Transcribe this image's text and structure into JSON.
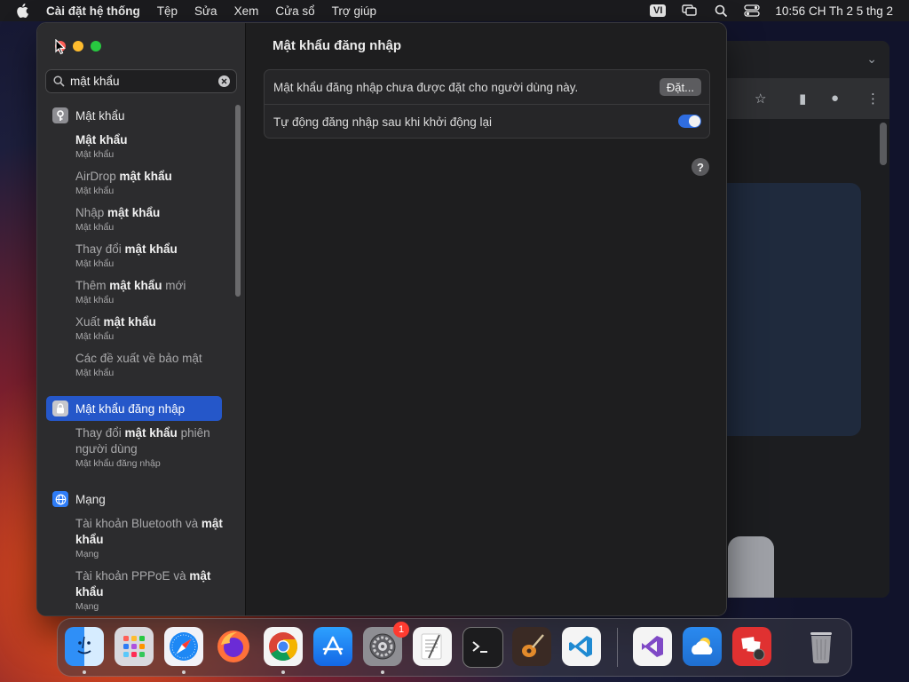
{
  "menubar": {
    "app": "Cài đặt hệ thống",
    "items": [
      "Tệp",
      "Sửa",
      "Xem",
      "Cửa sổ",
      "Trợ giúp"
    ],
    "input_method": "VI",
    "clock": "10:56 CH Th 2 5 thg 2"
  },
  "search": {
    "value": "mật khẩu"
  },
  "sidebar": {
    "sec1": {
      "label": "Mật khẩu"
    },
    "sec1_results": [
      {
        "before": "",
        "bold": "Mật khẩu",
        "after": "",
        "sub": "Mật khẩu"
      },
      {
        "before": "AirDrop ",
        "bold": "mật khẩu",
        "after": "",
        "sub": "Mật khẩu"
      },
      {
        "before": "Nhập ",
        "bold": "mật khẩu",
        "after": "",
        "sub": "Mật khẩu"
      },
      {
        "before": "Thay đổi ",
        "bold": "mật khẩu",
        "after": "",
        "sub": "Mật khẩu"
      },
      {
        "before": "Thêm ",
        "bold": "mật khẩu",
        "after": " mới",
        "sub": "Mật khẩu"
      },
      {
        "before": "Xuất ",
        "bold": "mật khẩu",
        "after": "",
        "sub": "Mật khẩu"
      },
      {
        "before": "Các đề xuất về bảo mật",
        "bold": "",
        "after": "",
        "sub": "Mật khẩu"
      }
    ],
    "sec2": {
      "label": "Mật khẩu đăng nhập"
    },
    "sec2_result": {
      "before": "Thay đổi ",
      "bold": "mật khẩu",
      "after": " phiên người dùng",
      "sub": "Mật khẩu đăng nhập"
    },
    "sec3": {
      "label": "Mạng"
    },
    "sec3_results": [
      {
        "before": "Tài khoản Bluetooth và ",
        "bold": "mật khẩu",
        "after": "",
        "sub": "Mạng"
      },
      {
        "before": "Tài khoản PPPoE và ",
        "bold": "mật khẩu",
        "after": "",
        "sub": "Mạng"
      }
    ]
  },
  "main": {
    "title": "Mật khẩu đăng nhập",
    "row1_label": "Mật khẩu đăng nhập chưa được đặt cho người dùng này.",
    "set_button": "Đặt...",
    "row2_label": "Tự động đăng nhập sau khi khởi động lại",
    "auto_login": true,
    "help": "?"
  },
  "dock": {
    "apps": [
      "finder-icon",
      "launchpad-icon",
      "safari-icon",
      "firefox-icon",
      "chrome-icon",
      "app-store-icon",
      "system-settings-icon",
      "textedit-icon",
      "terminal-icon",
      "garageband-icon",
      "vscode-icon",
      "visual-studio-icon",
      "weather-icon",
      "photo-booth-icon",
      "trash-icon"
    ],
    "settings_badge": "1"
  }
}
